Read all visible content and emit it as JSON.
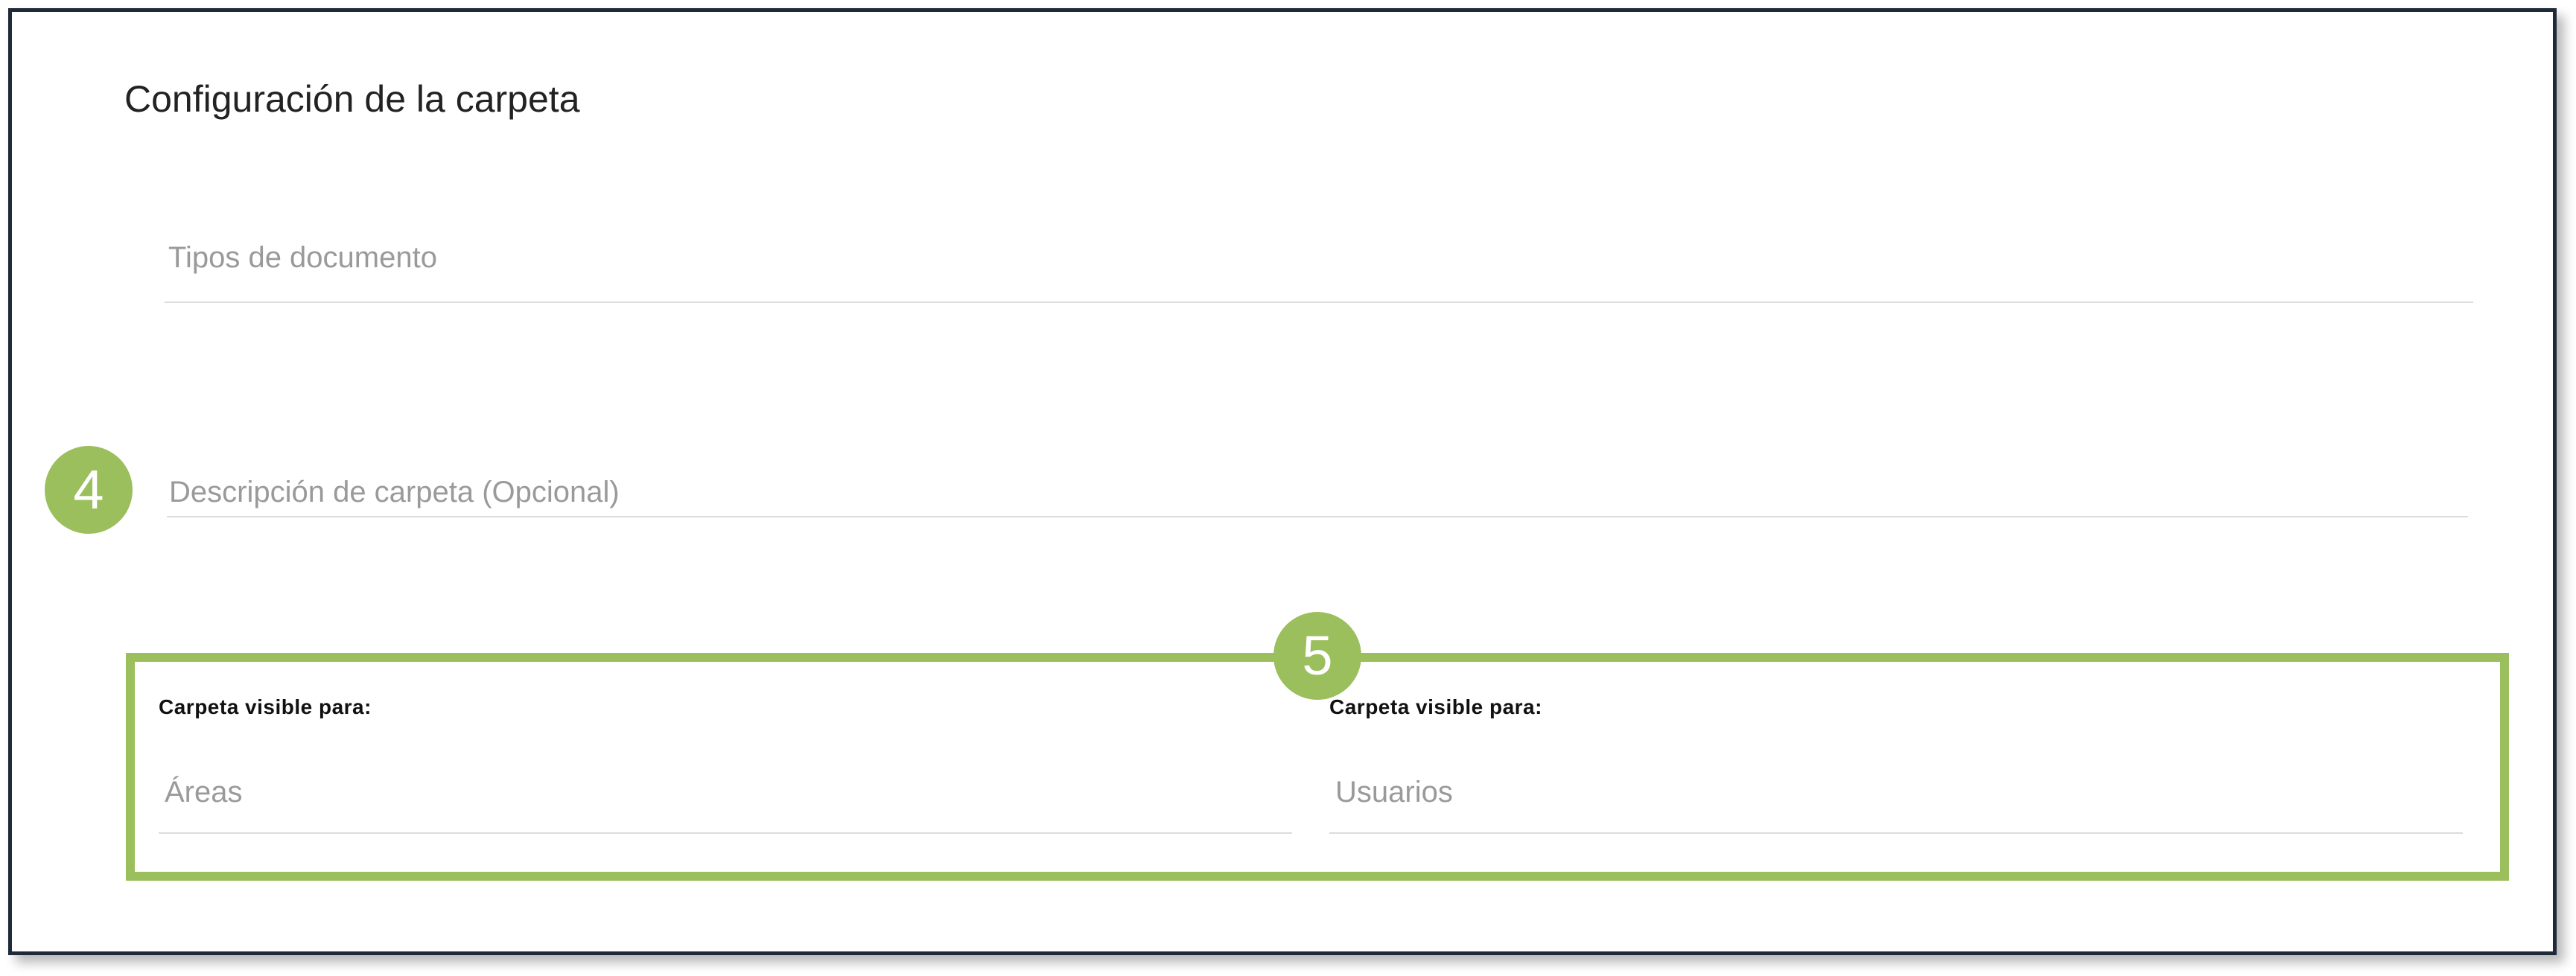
{
  "page_title": "Configuración de la carpeta",
  "fields": {
    "document_types": {
      "placeholder": "Tipos de documento",
      "value": ""
    },
    "folder_description": {
      "placeholder": "Descripción de carpeta (Opcional)",
      "value": ""
    }
  },
  "visibility": {
    "areas": {
      "label": "Carpeta visible para:",
      "placeholder": "Áreas",
      "value": ""
    },
    "users": {
      "label": "Carpeta visible para:",
      "placeholder": "Usuarios",
      "value": ""
    }
  },
  "markers": {
    "step_4": "4",
    "step_5": "5"
  },
  "colors": {
    "accent_green": "#9bbf5d",
    "frame_border": "#1e2a3a",
    "placeholder_text": "#9a9a9a",
    "field_underline": "#dcdcdc"
  }
}
